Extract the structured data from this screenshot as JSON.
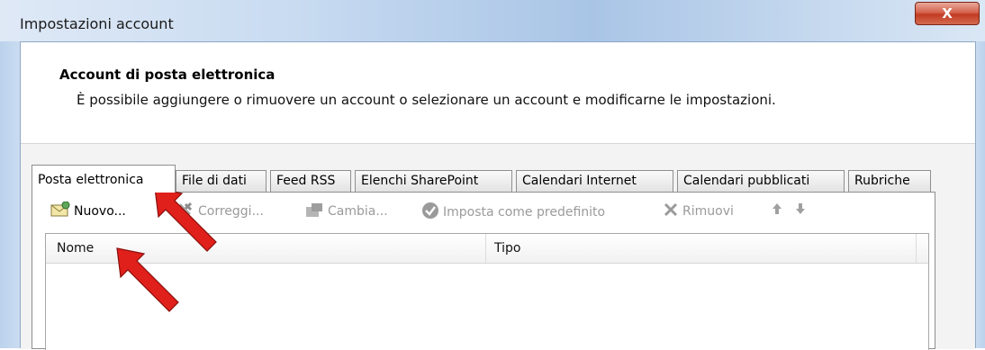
{
  "window": {
    "title": "Impostazioni account",
    "close_label": "X"
  },
  "header": {
    "title": "Account di posta elettronica",
    "description": "È possibile aggiungere o rimuovere un account o selezionare un account e modificarne le impostazioni."
  },
  "tabs": [
    {
      "label": "Posta elettronica",
      "active": true
    },
    {
      "label": "File di dati"
    },
    {
      "label": "Feed RSS"
    },
    {
      "label": "Elenchi SharePoint"
    },
    {
      "label": "Calendari Internet"
    },
    {
      "label": "Calendari pubblicati"
    },
    {
      "label": "Rubriche"
    }
  ],
  "toolbar": {
    "new_label": "Nuovo...",
    "repair_label": "Correggi...",
    "change_label": "Cambia...",
    "default_label": "Imposta come predefinito",
    "remove_label": "Rimuovi",
    "up_icon": "arrow-up-icon",
    "down_icon": "arrow-down-icon"
  },
  "list": {
    "columns": [
      "Nome",
      "Tipo"
    ],
    "rows": []
  },
  "annotations": {
    "arrow_color": "#e0201b"
  }
}
